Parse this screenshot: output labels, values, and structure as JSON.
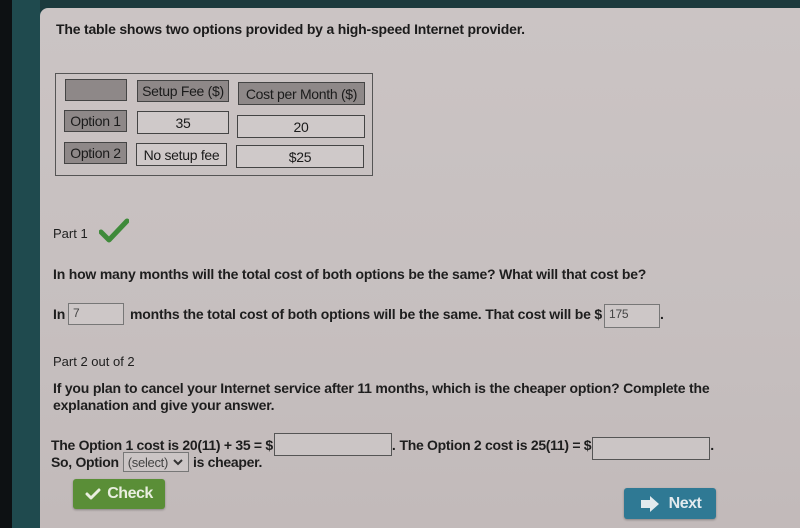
{
  "question": {
    "title": "The table shows two options provided by a high-speed Internet provider.",
    "table": {
      "headers": [
        "",
        "Setup Fee ($)",
        "Cost per Month ($)"
      ],
      "rows": [
        {
          "label": "Option 1",
          "setup_fee": "35",
          "cost_per_month": "20"
        },
        {
          "label": "Option 2",
          "setup_fee": "No setup fee",
          "cost_per_month": "$25"
        }
      ]
    }
  },
  "part1": {
    "label": "Part 1",
    "status_icon": "checkmark-icon",
    "prompt": "In how many months will the total cost of both options be the same? What will that cost be?",
    "answer_prefix": "In",
    "months_value": "7",
    "answer_middle": "months the total cost of both options will be the same. That cost will be $",
    "cost_value": "175",
    "answer_suffix": "."
  },
  "part2": {
    "label": "Part 2 out of 2",
    "prompt": "If you plan to cancel your Internet service after 11 months, which is the cheaper option? Complete the explanation and give your answer.",
    "option1_text": "The Option 1 cost is 20(11) + 35 = $",
    "option1_value": "",
    "separator": ".",
    "option2_text": "The Option 2 cost is 25(11) = $",
    "option2_value": "",
    "end": ".",
    "so_prefix": "So, Option",
    "select_value": "(select)",
    "so_suffix": "is cheaper."
  },
  "buttons": {
    "check_label": "Check",
    "next_label": "Next"
  },
  "colors": {
    "check_green": "#5a8e37",
    "next_blue": "#2f7994",
    "checkmark_green": "#3f8a3a",
    "header_gray": "#8e8888"
  }
}
